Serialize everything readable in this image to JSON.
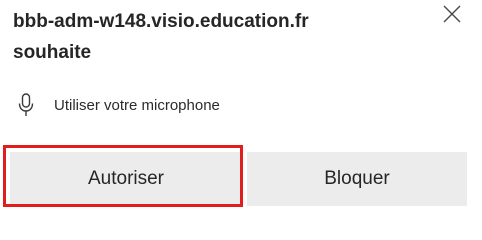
{
  "prompt": {
    "site": "bbb-adm-w148.visio.education.fr",
    "request_verb": "souhaite"
  },
  "permission": {
    "icon": "microphone-icon",
    "label": "Utiliser votre microphone"
  },
  "buttons": {
    "allow_label": "Autoriser",
    "block_label": "Bloquer"
  },
  "close": {
    "icon": "close-icon"
  },
  "colors": {
    "highlight": "#e01e1e",
    "button_bg": "#ececec"
  }
}
